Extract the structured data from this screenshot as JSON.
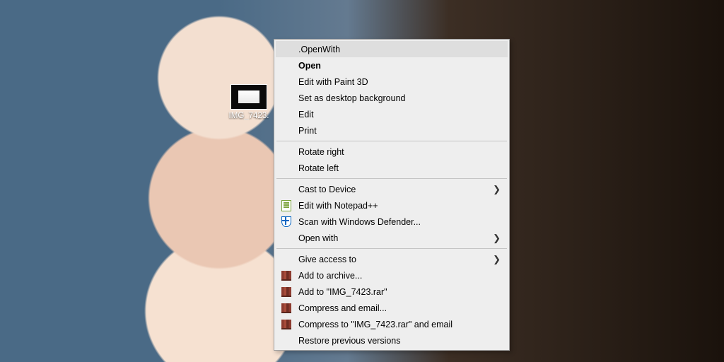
{
  "desktop_icon": {
    "label": "IMG_7423."
  },
  "menu": {
    "groups": [
      [
        {
          "label": ".OpenWith",
          "highlight": true
        },
        {
          "label": "Open",
          "bold": true
        },
        {
          "label": "Edit with Paint 3D"
        },
        {
          "label": "Set as desktop background"
        },
        {
          "label": "Edit"
        },
        {
          "label": "Print"
        }
      ],
      [
        {
          "label": "Rotate right"
        },
        {
          "label": "Rotate left"
        }
      ],
      [
        {
          "label": "Cast to Device",
          "submenu": true
        },
        {
          "label": "Edit with Notepad++",
          "icon": "notepadpp-icon"
        },
        {
          "label": "Scan with Windows Defender...",
          "icon": "defender-shield-icon"
        },
        {
          "label": "Open with",
          "submenu": true
        }
      ],
      [
        {
          "label": "Give access to",
          "submenu": true
        },
        {
          "label": "Add to archive...",
          "icon": "winrar-icon"
        },
        {
          "label": "Add to \"IMG_7423.rar\"",
          "icon": "winrar-icon"
        },
        {
          "label": "Compress and email...",
          "icon": "winrar-icon"
        },
        {
          "label": "Compress to \"IMG_7423.rar\" and email",
          "icon": "winrar-icon"
        },
        {
          "label": "Restore previous versions"
        }
      ]
    ]
  }
}
